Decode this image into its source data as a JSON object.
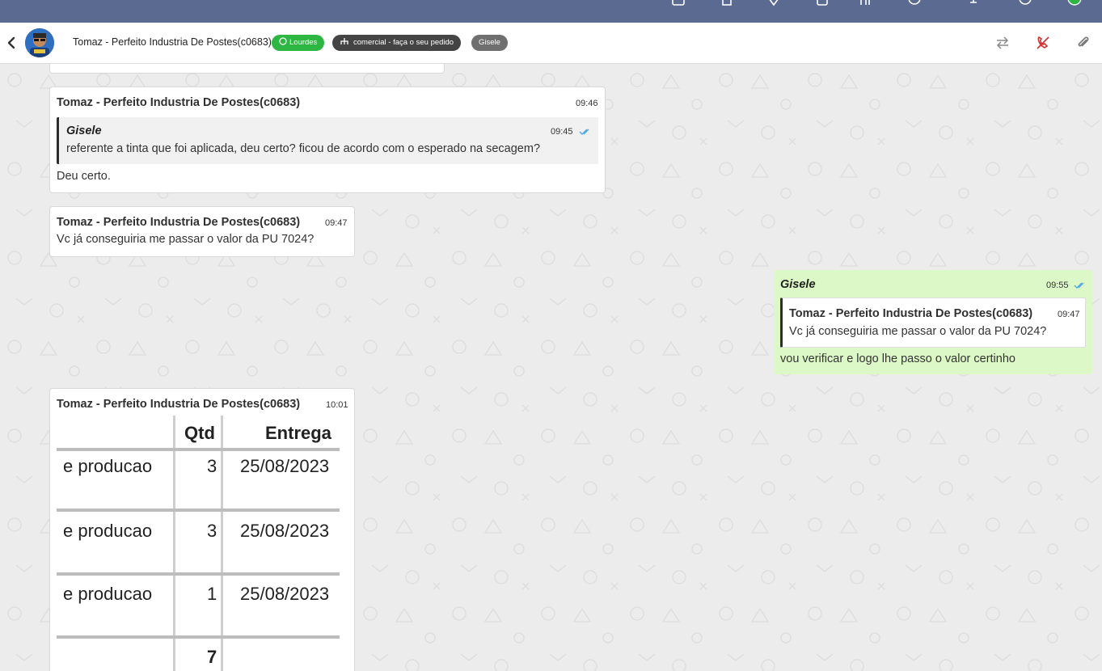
{
  "header": {
    "contact_name": "Tomaz - Perfeito Industria De Postes(c0683)",
    "tag_whatsapp": "Lourdes",
    "tag_queue": "comercial - faça o seu pedido",
    "tag_user": "Gisele"
  },
  "messages": [
    {
      "sender": "Tomaz - Perfeito Industria De Postes(c0683)",
      "time": "09:46",
      "quote": {
        "sender": "Gisele",
        "time": "09:45",
        "text": "referente a tinta que foi aplicada, deu certo? ficou de acordo com o esperado na secagem?"
      },
      "text": "Deu certo."
    },
    {
      "sender": "Tomaz - Perfeito Industria De Postes(c0683)",
      "time": "09:47",
      "text": "Vc já conseguiria me passar o valor da PU 7024?"
    },
    {
      "sender": "Gisele",
      "time": "09:55",
      "quote": {
        "sender": "Tomaz - Perfeito Industria De Postes(c0683)",
        "time": "09:47",
        "text": "Vc já conseguiria me passar o valor da PU 7024?"
      },
      "text": "vou verificar e logo lhe passo o valor certinho"
    },
    {
      "sender": "Tomaz - Perfeito Industria De Postes(c0683)",
      "time": "10:01",
      "image_table": {
        "headers": [
          "Qtd",
          "Entrega"
        ],
        "rows": [
          {
            "desc": "e producao",
            "qtd": "3",
            "entrega": "25/08/2023"
          },
          {
            "desc": "e producao",
            "qtd": "3",
            "entrega": "25/08/2023"
          },
          {
            "desc": "e producao",
            "qtd": "1",
            "entrega": "25/08/2023"
          }
        ],
        "total": "7"
      }
    }
  ],
  "colors": {
    "topbar": "#5a6a90",
    "outgoing_bubble": "#dcf8c6",
    "read_ticks": "#4fa8e8",
    "badge_green": "#2db742"
  },
  "icons": [
    "back-icon",
    "whatsapp-icon",
    "queue-icon",
    "transfer-icon",
    "end-call-icon",
    "attach-icon",
    "double-check-icon"
  ]
}
